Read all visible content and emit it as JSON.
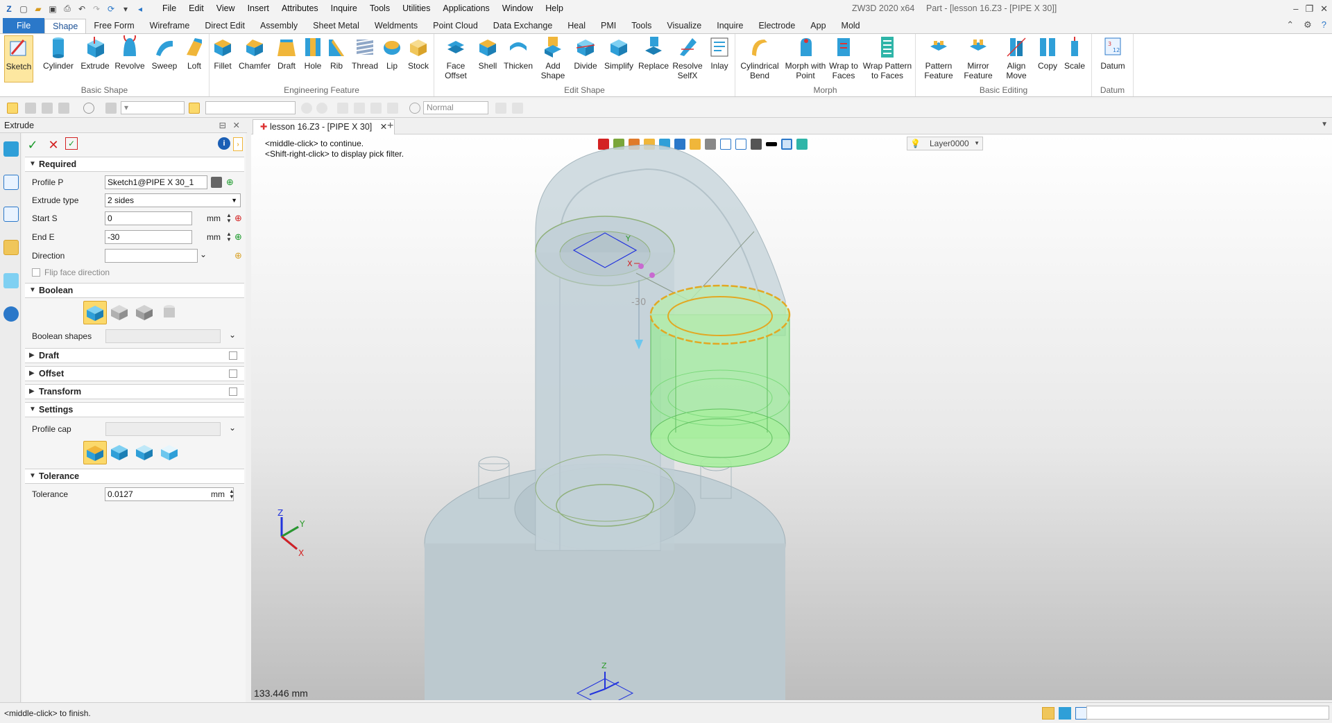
{
  "titlebar": {
    "menus": [
      "File",
      "Edit",
      "View",
      "Insert",
      "Attributes",
      "Inquire",
      "Tools",
      "Utilities",
      "Applications",
      "Window",
      "Help"
    ],
    "app_title": "ZW3D 2020 x64",
    "part_title": "Part - [lesson 16.Z3 - [PIPE X 30]]"
  },
  "ribbon_tabs": [
    "File",
    "Shape",
    "Free Form",
    "Wireframe",
    "Direct Edit",
    "Assembly",
    "Sheet Metal",
    "Weldments",
    "Point Cloud",
    "Data Exchange",
    "Heal",
    "PMI",
    "Tools",
    "Visualize",
    "Inquire",
    "Electrode",
    "App",
    "Mold"
  ],
  "ribbon": {
    "groups": [
      {
        "title": "Basic Shape",
        "buttons": [
          "Sketch",
          "Cylinder",
          "Extrude",
          "Revolve",
          "Sweep",
          "Loft"
        ]
      },
      {
        "title": "Engineering Feature",
        "buttons": [
          "Fillet",
          "Chamfer",
          "Draft",
          "Hole",
          "Rib",
          "Thread",
          "Lip",
          "Stock"
        ]
      },
      {
        "title": "Edit Shape",
        "buttons": [
          "Face Offset",
          "Shell",
          "Thicken",
          "Add Shape",
          "Divide",
          "Simplify",
          "Replace",
          "Resolve SelfX",
          "Inlay"
        ]
      },
      {
        "title": "Morph",
        "buttons": [
          "Cylindrical Bend",
          "Morph with Point",
          "Wrap to Faces",
          "Wrap Pattern to Faces"
        ]
      },
      {
        "title": "Basic Editing",
        "buttons": [
          "Pattern Feature",
          "Mirror Feature",
          "Align Move",
          "Copy",
          "Scale"
        ]
      },
      {
        "title": "Datum",
        "buttons": [
          "Datum"
        ]
      }
    ]
  },
  "toolbar2": {
    "render_mode": "Normal"
  },
  "panel": {
    "title": "Extrude",
    "sections": {
      "required": "Required",
      "boolean": "Boolean",
      "draft": "Draft",
      "offset": "Offset",
      "transform": "Transform",
      "settings": "Settings",
      "tolerance": "Tolerance"
    },
    "fields": {
      "profile_label": "Profile P",
      "profile_value": "Sketch1@PIPE X 30_1",
      "extrude_type_label": "Extrude type",
      "extrude_type_value": "2 sides",
      "start_label": "Start S",
      "start_value": "0",
      "end_label": "End E",
      "end_value": "-30",
      "unit": "mm",
      "direction_label": "Direction",
      "flip_label": "Flip face direction",
      "boolean_shapes_label": "Boolean shapes",
      "profile_cap_label": "Profile cap",
      "tolerance_label": "Tolerance",
      "tolerance_value": "0.0127"
    }
  },
  "document": {
    "tab_label": "lesson 16.Z3 - [PIPE X 30]"
  },
  "viewport": {
    "hint_line1": "<middle-click> to continue.",
    "hint_line2": "<Shift-right-click> to display pick filter.",
    "layer": "Layer0000",
    "scale_readout": "133.446 mm",
    "dimension_label": "-30",
    "triad": {
      "x": "X",
      "y": "Y",
      "z": "Z"
    }
  },
  "status": {
    "text": "<middle-click> to finish."
  }
}
